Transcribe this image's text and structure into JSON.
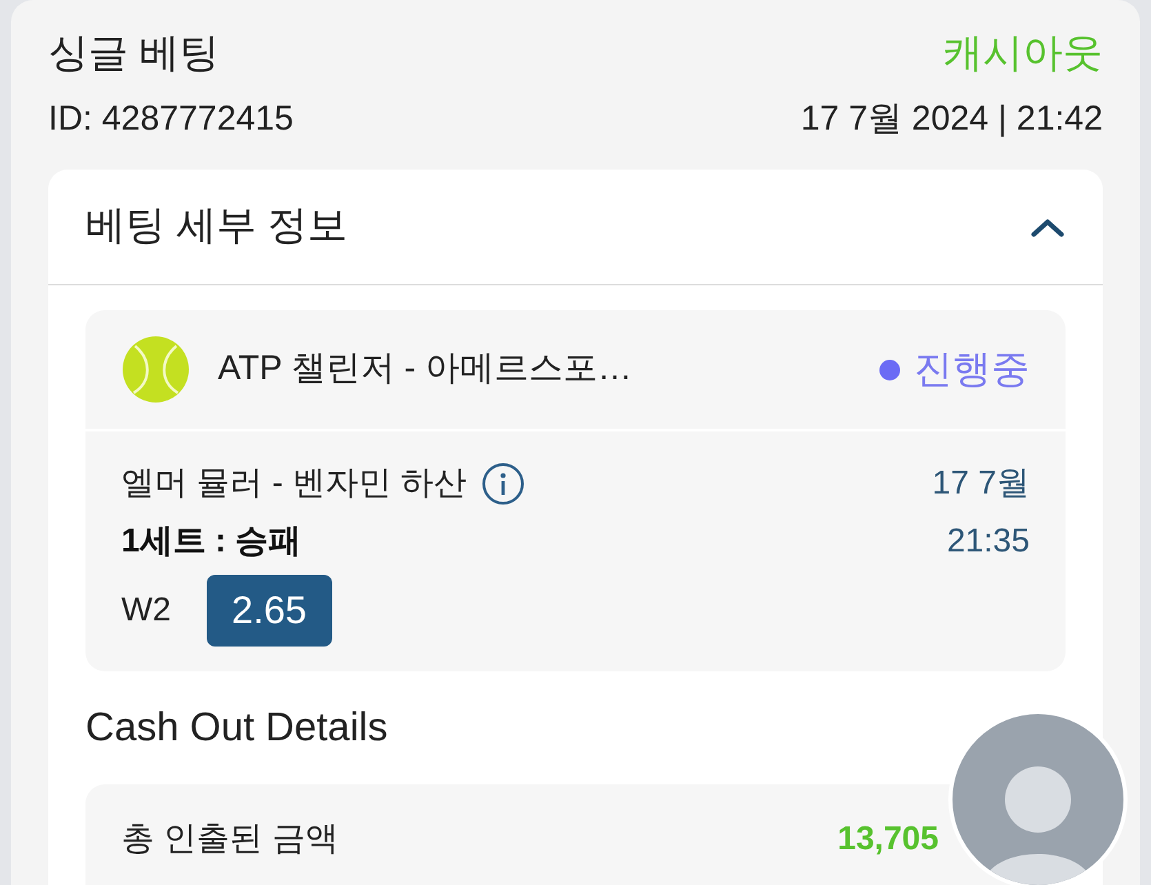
{
  "header": {
    "title": "싱글 베팅",
    "status": "캐시아웃",
    "id": "ID: 4287772415",
    "datetime": "17 7월 2024 | 21:42"
  },
  "details": {
    "title": "베팅 세부 정보",
    "expanded": true,
    "event": {
      "tournament": "ATP 챌린저 - 아메르스포…",
      "status": {
        "label": "진행중",
        "color": "#6b6bf5"
      },
      "match": "엘머 뮬러 - 벤자민 하산",
      "date": "17 7월",
      "market": "1세트 : 승패",
      "time": "21:35",
      "outcome": "W2",
      "odds": "2.65"
    }
  },
  "cashout": {
    "title": "Cash Out Details",
    "rows": [
      {
        "label": "총 인출된 금액",
        "value": "13,705"
      }
    ]
  }
}
